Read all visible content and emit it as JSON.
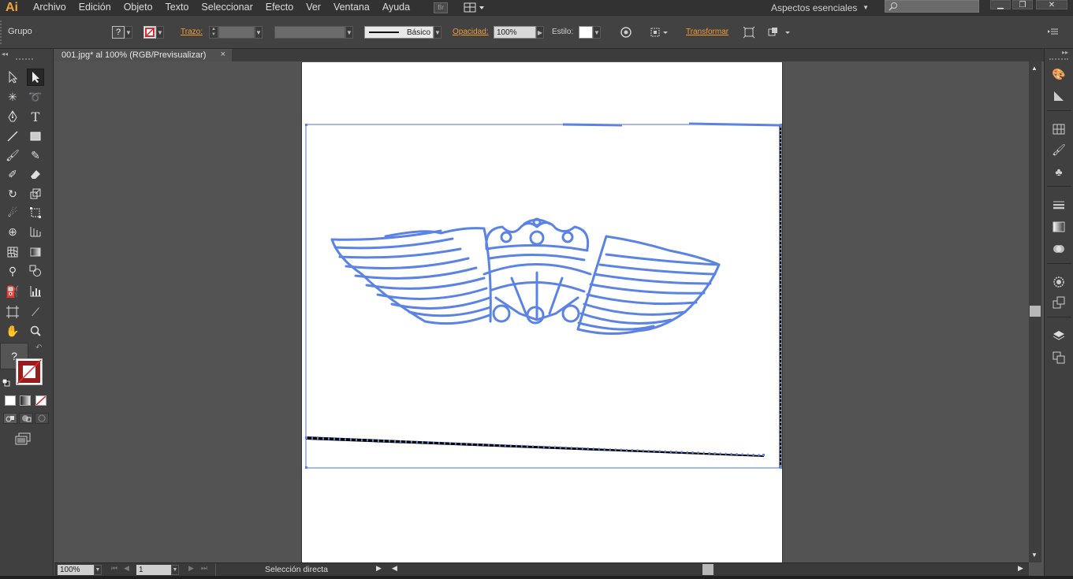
{
  "app": {
    "logo": "Ai",
    "accent": "#f2a33a"
  },
  "menu": [
    "Archivo",
    "Edición",
    "Objeto",
    "Texto",
    "Seleccionar",
    "Efecto",
    "Ver",
    "Ventana",
    "Ayuda"
  ],
  "menubar": {
    "bridge_label": "Br",
    "workspace": "Aspectos esenciales",
    "search_placeholder": "",
    "search_icon": "search-icon"
  },
  "controlbar": {
    "selection_type": "Grupo",
    "fill_value": "?",
    "stroke_label": "Trazo:",
    "stroke_profile": "Básico",
    "opacity_label": "Opacidad:",
    "opacity_value": "100%",
    "style_label": "Estilo:",
    "transform_label": "Transformar"
  },
  "document_tab": {
    "title": "001.jpg* al 100% (RGB/Previsualizar)",
    "close": "×"
  },
  "toolbox": {
    "fill_unknown": "?"
  },
  "statusbar": {
    "zoom": "100%",
    "artboard_number": "1",
    "status_text": "Selección directa"
  },
  "artwork": {
    "path_color": "#5b83e6",
    "stroke_color": "#000000",
    "selection_color": "#4a76d8"
  }
}
